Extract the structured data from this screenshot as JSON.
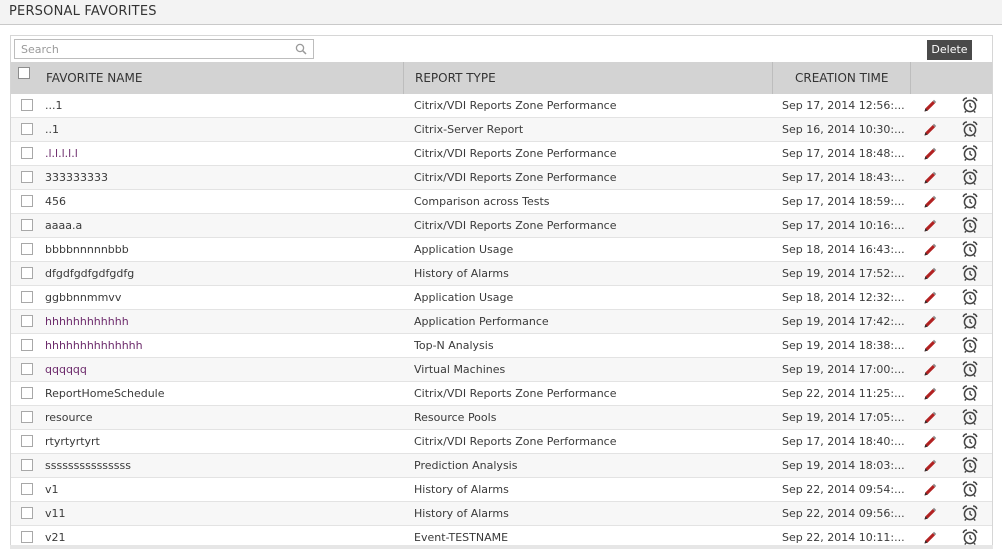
{
  "page": {
    "title": "PERSONAL FAVORITES"
  },
  "search": {
    "placeholder": "Search",
    "value": ""
  },
  "toolbar": {
    "delete_label": "Delete"
  },
  "table": {
    "columns": {
      "name": "FAVORITE NAME",
      "type": "REPORT TYPE",
      "time": "CREATION TIME"
    },
    "rows": [
      {
        "name": "...1",
        "type": "Citrix/VDI Reports Zone Performance",
        "time": "Sep 17, 2014 12:56:...",
        "name_color": "#3a3a3a"
      },
      {
        "name": "..1",
        "type": "Citrix-Server Report",
        "time": "Sep 16, 2014 10:30:...",
        "name_color": "#3a3a3a"
      },
      {
        "name": ".l.l.l.l.l",
        "type": "Citrix/VDI Reports Zone Performance",
        "time": "Sep 17, 2014 18:48:...",
        "name_color": "#6c2a6b"
      },
      {
        "name": "333333333",
        "type": "Citrix/VDI Reports Zone Performance",
        "time": "Sep 17, 2014 18:43:...",
        "name_color": "#3a3a3a"
      },
      {
        "name": "456",
        "type": "Comparison across Tests",
        "time": "Sep 17, 2014 18:59:...",
        "name_color": "#3a3a3a"
      },
      {
        "name": "aaaa.a",
        "type": "Citrix/VDI Reports Zone Performance",
        "time": "Sep 17, 2014 10:16:...",
        "name_color": "#3a3a3a"
      },
      {
        "name": "bbbbnnnnnbbb",
        "type": "Application Usage",
        "time": "Sep 18, 2014 16:43:...",
        "name_color": "#3a3a3a"
      },
      {
        "name": "dfgdfgdfgdfgdfg",
        "type": "History of Alarms",
        "time": "Sep 19, 2014 17:52:...",
        "name_color": "#3a3a3a"
      },
      {
        "name": "ggbbnnmmvv",
        "type": "Application Usage",
        "time": "Sep 18, 2014 12:32:...",
        "name_color": "#3a3a3a"
      },
      {
        "name": "hhhhhhhhhhhh",
        "type": "Application Performance",
        "time": "Sep 19, 2014 17:42:...",
        "name_color": "#6c2a6b"
      },
      {
        "name": "hhhhhhhhhhhhhh",
        "type": "Top-N Analysis",
        "time": "Sep 19, 2014 18:38:...",
        "name_color": "#6c2a6b"
      },
      {
        "name": "qqqqqq",
        "type": "Virtual Machines",
        "time": "Sep 19, 2014 17:00:...",
        "name_color": "#6c2a6b"
      },
      {
        "name": "ReportHomeSchedule",
        "type": "Citrix/VDI Reports Zone Performance",
        "time": "Sep 22, 2014 11:25:...",
        "name_color": "#3a3a3a"
      },
      {
        "name": "resource",
        "type": "Resource Pools",
        "time": "Sep 19, 2014 17:05:...",
        "name_color": "#3a3a3a"
      },
      {
        "name": "rtyrtyrtyrt",
        "type": "Citrix/VDI Reports Zone Performance",
        "time": "Sep 17, 2014 18:40:...",
        "name_color": "#3a3a3a"
      },
      {
        "name": "sssssssssssssss",
        "type": "Prediction Analysis",
        "time": "Sep 19, 2014 18:03:...",
        "name_color": "#3a3a3a"
      },
      {
        "name": "v1",
        "type": "History of Alarms",
        "time": "Sep 22, 2014 09:54:...",
        "name_color": "#3a3a3a"
      },
      {
        "name": "v11",
        "type": "History of Alarms",
        "time": "Sep 22, 2014 09:56:...",
        "name_color": "#3a3a3a"
      },
      {
        "name": "v21",
        "type": "Event-TESTNAME",
        "time": "Sep 22, 2014 10:11:...",
        "name_color": "#3a3a3a"
      }
    ]
  },
  "icons": {
    "edit": "pencil-icon",
    "schedule": "alarm-clock-icon",
    "search": "search-icon"
  },
  "colors": {
    "header_bg": "#d3d3d3",
    "button_bg": "#4a4a4a",
    "edit_icon": "#b22222",
    "link_purple": "#6c2a6b"
  }
}
